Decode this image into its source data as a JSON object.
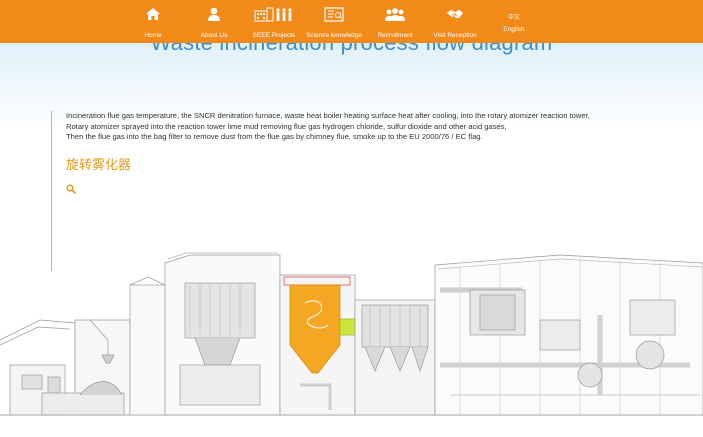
{
  "nav": {
    "items": [
      {
        "label": "Home",
        "icon": "house-icon"
      },
      {
        "label": "About Us",
        "icon": "person-icon"
      },
      {
        "label": "SEEE Projects",
        "icon": "building-people-icon"
      },
      {
        "label": "Science knowledge",
        "icon": "board-icon"
      },
      {
        "label": "Recruitment",
        "icon": "group-icon"
      },
      {
        "label": "Visit Reception",
        "icon": "handshake-icon"
      }
    ],
    "lang_cn": "中文",
    "lang_en": "English"
  },
  "page": {
    "title": "Waste incineration process flow diagram",
    "description": [
      "Incineration flue gas temperature, the SNCR denitration furnace, waste heat boiler heating surface heat after cooling, into the rotary atomizer reaction tower,",
      "Rotary atomizer sprayed into the reaction tower lime mud removing flue gas hydrogen chloride, sulfur dioxide and other acid gases,",
      "Then the flue gas into the bag filter to remove dust from the flue gas by chimney flue, smoke up to the EU 2000/76 / EC flag."
    ],
    "subtitle": "旋转雾化器"
  },
  "colors": {
    "nav_bg": "#f28a1a",
    "title": "#3d8fd1",
    "subtitle": "#e39b1c",
    "highlight": "#f5a623",
    "accent_green": "#c8e63c"
  },
  "icons": {
    "zoom": "magnifier-icon"
  }
}
